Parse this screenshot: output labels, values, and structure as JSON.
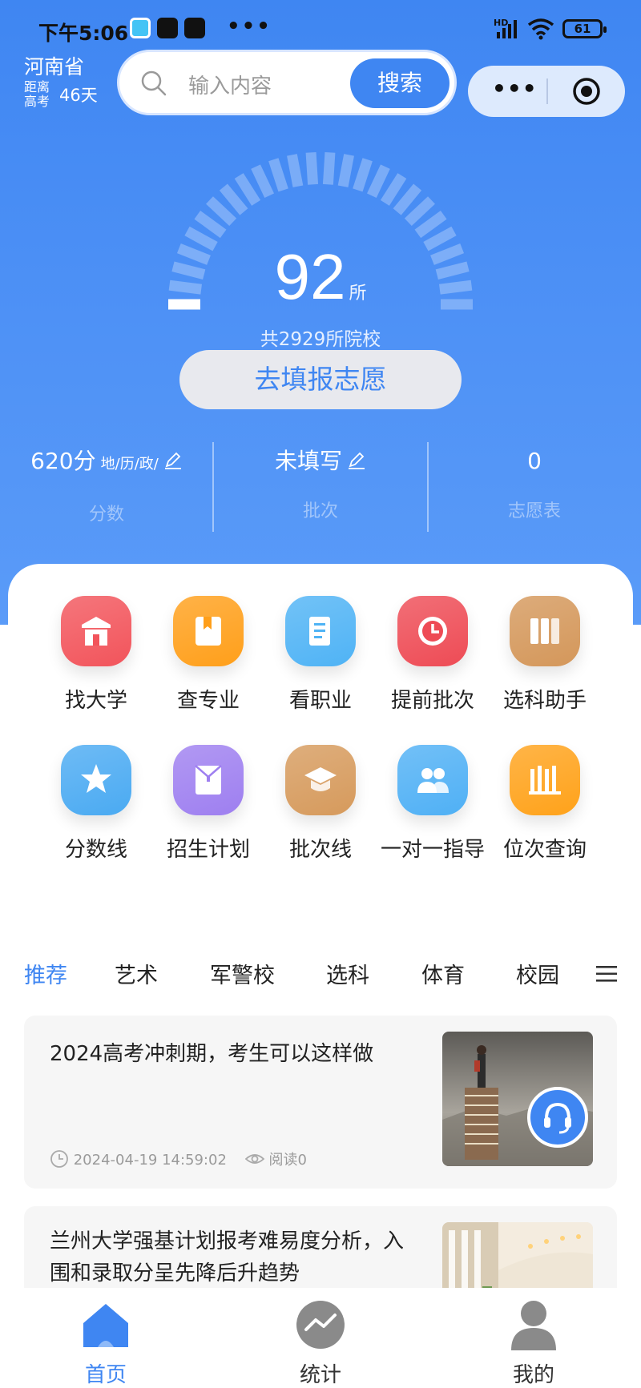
{
  "status_bar": {
    "time": "下午5:06",
    "hd": "HD",
    "battery": "61"
  },
  "header": {
    "province": "河南省",
    "countdown_prefix": "距离高考",
    "countdown_days": "46天",
    "search_placeholder": "输入内容",
    "search_button": "搜索",
    "more": "•••"
  },
  "gauge": {
    "count": "92",
    "unit": "所",
    "total_text": "共2929所院校",
    "fill_fraction": 0.031
  },
  "fill_button": "去填报志愿",
  "stats": [
    {
      "value": "620分",
      "suffix": "地/历/政/",
      "label": "分数"
    },
    {
      "value": "未填写",
      "suffix": "",
      "label": "批次"
    },
    {
      "value": "0",
      "suffix": "",
      "label": "志愿表"
    }
  ],
  "grid": [
    {
      "label": "找大学",
      "icon": "university-icon",
      "color": "#f2545b"
    },
    {
      "label": "查专业",
      "icon": "bookmark-book-icon",
      "color": "#ff9f1a"
    },
    {
      "label": "看职业",
      "icon": "document-icon",
      "color": "#4fb3f5"
    },
    {
      "label": "提前批次",
      "icon": "clock-icon",
      "color": "#ee4b55"
    },
    {
      "label": "选科助手",
      "icon": "books-icon",
      "color": "#d4975a"
    },
    {
      "label": "分数线",
      "icon": "star-icon",
      "color": "#4aaaf2"
    },
    {
      "label": "招生计划",
      "icon": "envelope-icon",
      "color": "#9e7ff0"
    },
    {
      "label": "批次线",
      "icon": "graduation-cap-icon",
      "color": "#d69a5c"
    },
    {
      "label": "一对一指导",
      "icon": "users-icon",
      "color": "#4fb0f5"
    },
    {
      "label": "位次查询",
      "icon": "ranking-icon",
      "color": "#ffa21a"
    }
  ],
  "tabs": [
    "推荐",
    "艺术",
    "军警校",
    "选科",
    "体育",
    "校园"
  ],
  "articles": [
    {
      "title": "2024高考冲刺期，考生可以这样做",
      "date": "2024-04-19 14:59:02",
      "views": "阅读0"
    },
    {
      "title": "兰州大学强基计划报考难易度分析，入围和录取分呈先降后升趋势",
      "date": "",
      "views": ""
    }
  ],
  "nav": [
    {
      "label": "首页",
      "icon": "home-icon"
    },
    {
      "label": "统计",
      "icon": "stats-icon"
    },
    {
      "label": "我的",
      "icon": "profile-icon"
    }
  ],
  "colors": {
    "accent": "#3f86f2",
    "hero_top": "#3f86f2",
    "button_bg": "#e8e9ee"
  }
}
